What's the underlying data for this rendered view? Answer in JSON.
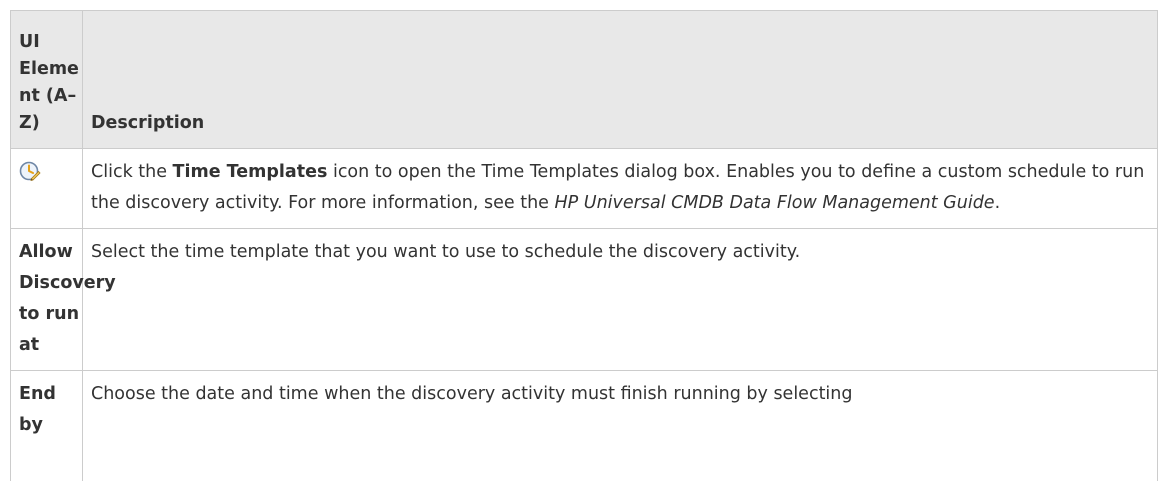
{
  "table": {
    "headers": {
      "element": "UI Element (A–Z)",
      "description": "Description"
    },
    "rows": [
      {
        "element_icon": "time-templates-icon",
        "description": {
          "part1": "Click the ",
          "bold": "Time Templates",
          "part2": " icon to open the Time Templates dialog box. Enables you to define a custom schedule to run the discovery activity. For more information, see the ",
          "italic": "HP Universal CMDB Data Flow Management Guide",
          "part3": "."
        }
      },
      {
        "element": "Allow Discovery to run at",
        "description": "Select the time template that you want to use to schedule the discovery activity."
      },
      {
        "element": "End by",
        "description": "Choose the date and time when the discovery activity must finish running by selecting"
      }
    ]
  },
  "colors": {
    "header_bg": "#e8e8e8",
    "border": "#cccccc",
    "text": "#333333"
  }
}
